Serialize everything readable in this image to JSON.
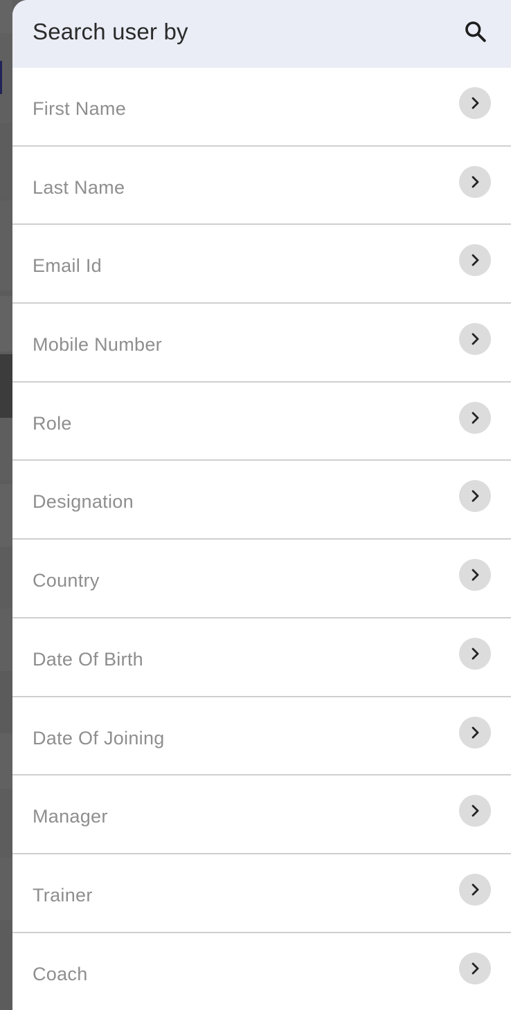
{
  "header": {
    "title": "Search user by",
    "search_icon": "search-icon"
  },
  "options": [
    {
      "label": "First Name",
      "icon": "chevron-right-icon"
    },
    {
      "label": "Last Name",
      "icon": "chevron-right-icon"
    },
    {
      "label": "Email Id",
      "icon": "chevron-right-icon"
    },
    {
      "label": "Mobile Number",
      "icon": "chevron-right-icon"
    },
    {
      "label": "Role",
      "icon": "chevron-right-icon"
    },
    {
      "label": "Designation",
      "icon": "chevron-right-icon"
    },
    {
      "label": "Country",
      "icon": "chevron-right-icon"
    },
    {
      "label": "Date Of Birth",
      "icon": "chevron-right-icon"
    },
    {
      "label": "Date Of Joining",
      "icon": "chevron-right-icon"
    },
    {
      "label": "Manager",
      "icon": "chevron-right-icon"
    },
    {
      "label": "Trainer",
      "icon": "chevron-right-icon"
    },
    {
      "label": "Coach",
      "icon": "chevron-right-icon"
    }
  ],
  "colors": {
    "header_bg": "#eaedf5",
    "title_text": "#2b2b2b",
    "option_text": "#8e8e8e",
    "chevron_bg": "#dcdcdc",
    "divider": "#cfcfcf",
    "backdrop": "#5f5f5f"
  }
}
